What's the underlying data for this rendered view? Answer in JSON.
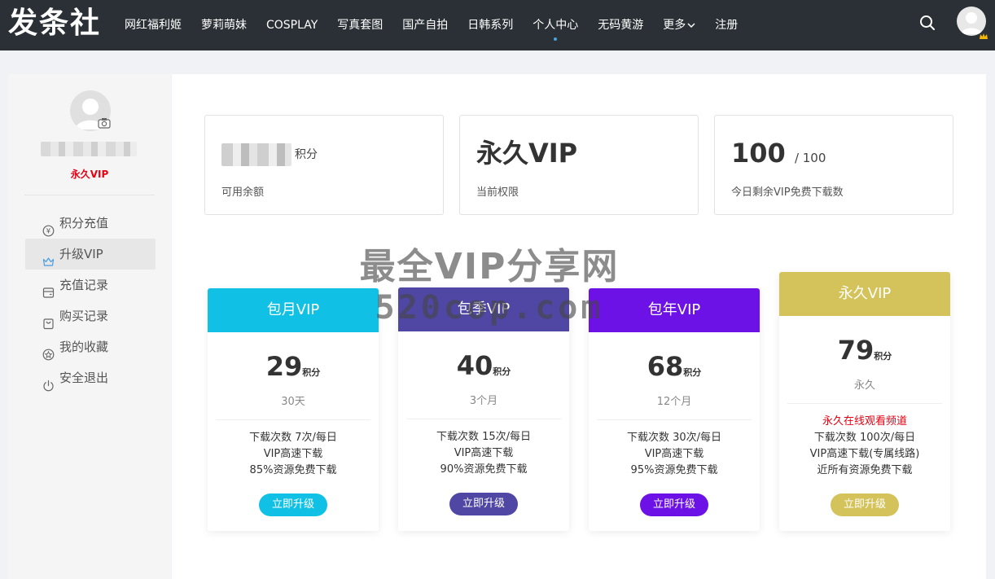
{
  "header": {
    "logo": "发条社",
    "nav": [
      {
        "label": "网红福利姬"
      },
      {
        "label": "萝莉萌妹"
      },
      {
        "label": "COSPLAY"
      },
      {
        "label": "写真套图"
      },
      {
        "label": "国产自拍"
      },
      {
        "label": "日韩系列"
      },
      {
        "label": "个人中心"
      },
      {
        "label": "无码黄游"
      },
      {
        "label": "更多"
      },
      {
        "label": "注册"
      }
    ]
  },
  "sidebar": {
    "vip_tag": "永久VIP",
    "menu": [
      {
        "label": "积分充值",
        "icon": "yen-coin-icon"
      },
      {
        "label": "升级VIP",
        "icon": "crown-icon"
      },
      {
        "label": "充值记录",
        "icon": "wallet-icon"
      },
      {
        "label": "购买记录",
        "icon": "bag-icon"
      },
      {
        "label": "我的收藏",
        "icon": "star-badge-icon"
      },
      {
        "label": "安全退出",
        "icon": "power-icon"
      }
    ]
  },
  "stats": {
    "points_unit": "积分",
    "points_label": "可用余额",
    "level_value": "永久VIP",
    "level_label": "当前权限",
    "downloads_value": "100",
    "downloads_total": "/ 100",
    "downloads_label": "今日剩余VIP免费下载数"
  },
  "watermark": {
    "line1": "最全VIP分享网",
    "line2": "520cop.com"
  },
  "plans": [
    {
      "name": "包月VIP",
      "price": "29",
      "unit": "积分",
      "period": "30天",
      "color": "#11c1e5",
      "features": [
        "下载次数 7次/每日",
        "VIP高速下载",
        "85%资源免费下载"
      ],
      "button": "立即升级"
    },
    {
      "name": "包季VIP",
      "price": "40",
      "unit": "积分",
      "period": "3个月",
      "color": "#4f47a3",
      "features": [
        "下载次数 15次/每日",
        "VIP高速下载",
        "90%资源免费下载"
      ],
      "button": "立即升级"
    },
    {
      "name": "包年VIP",
      "price": "68",
      "unit": "积分",
      "period": "12个月",
      "color": "#6d12e6",
      "features": [
        "下载次数 30次/每日",
        "VIP高速下载",
        "95%资源免费下载"
      ],
      "button": "立即升级"
    },
    {
      "name": "永久VIP",
      "price": "79",
      "unit": "积分",
      "period": "永久",
      "color": "#d4c35a",
      "highlight": "永久在线观看频道",
      "features": [
        "下载次数 100次/每日",
        "VIP高速下载(专属线路)",
        "近所有资源免费下载"
      ],
      "button": "立即升级"
    }
  ]
}
